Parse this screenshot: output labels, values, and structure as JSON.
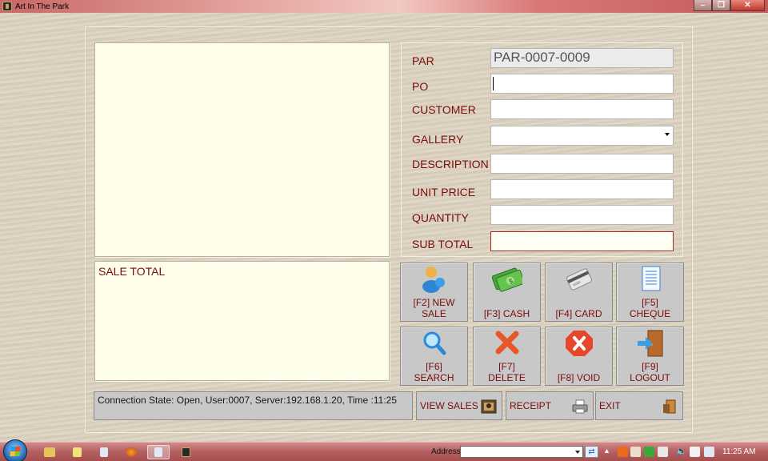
{
  "window": {
    "title": "Art In The Park"
  },
  "form": {
    "par_label": "PAR",
    "par_value": "PAR-0007-0009",
    "po_label": "PO",
    "po_value": "",
    "customer_label": "CUSTOMER",
    "customer_value": "",
    "gallery_label": "GALLERY",
    "gallery_value": "",
    "description_label": "DESCRIPTION",
    "description_value": "",
    "unit_price_label": "UNIT PRICE",
    "unit_price_value": "",
    "quantity_label": "QUANTITY",
    "quantity_value": "",
    "sub_total_label": "SUB TOTAL",
    "sub_total_value": ""
  },
  "sale": {
    "label": "SALE TOTAL"
  },
  "actions": [
    {
      "label": "[F2]  NEW\nSALE",
      "icon": "new-sale-icon"
    },
    {
      "label": "[F3] CASH",
      "icon": "cash-icon"
    },
    {
      "label": "[F4]  CARD",
      "icon": "card-icon"
    },
    {
      "label": "[F5]\nCHEQUE",
      "icon": "cheque-icon"
    },
    {
      "label": "[F6]\nSEARCH",
      "icon": "search-icon"
    },
    {
      "label": "[F7]\nDELETE",
      "icon": "delete-icon"
    },
    {
      "label": "[F8] VOID",
      "icon": "void-icon"
    },
    {
      "label": "[F9]\nLOGOUT",
      "icon": "logout-icon"
    }
  ],
  "status": {
    "text": "Connection State: Open, User:0007, Server:192.168.1.20, Time :11:25"
  },
  "bottom_buttons": {
    "view_sales": "VIEW SALES",
    "receipt": "RECEIPT",
    "exit": "EXIT"
  },
  "taskbar": {
    "address_label": "Address",
    "clock": "11:25 AM"
  },
  "colors": {
    "label_text": "#7a0c0c",
    "panel_bg": "#fffeeb",
    "button_bg": "#c8c8c8",
    "taskbar": "#b76363"
  }
}
